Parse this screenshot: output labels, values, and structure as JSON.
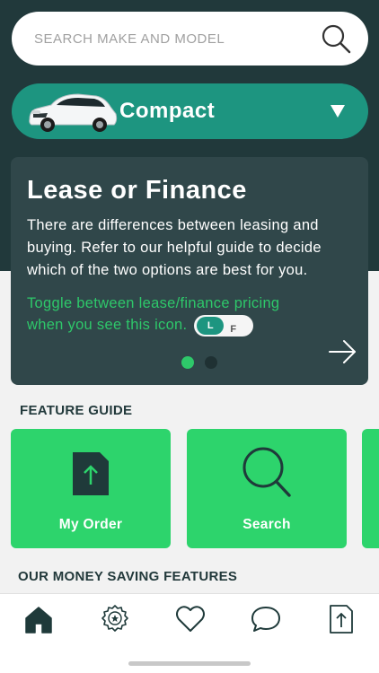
{
  "search": {
    "placeholder": "SEARCH MAKE AND MODEL"
  },
  "category": {
    "label": "Compact"
  },
  "promo": {
    "title": "Lease or Finance",
    "body": "There are differences between leasing and buying. Refer to our helpful guide to decide which of the two options are best for you.",
    "hint": "Toggle between lease/finance pricing when you see this icon.",
    "toggle": {
      "left": "L",
      "right": "F"
    },
    "pager": {
      "total": 2,
      "active": 1
    }
  },
  "feature_guide": {
    "title": "FEATURE GUIDE",
    "items": [
      {
        "label": "My Order",
        "icon": "order-document-icon"
      },
      {
        "label": "Search",
        "icon": "search-icon"
      }
    ]
  },
  "money_saving": {
    "title": "OUR MONEY SAVING FEATURES"
  },
  "tabbar": {
    "items": [
      {
        "name": "home",
        "icon": "home-icon",
        "active": true
      },
      {
        "name": "deals",
        "icon": "badge-icon"
      },
      {
        "name": "favorites",
        "icon": "heart-icon"
      },
      {
        "name": "messages",
        "icon": "chat-icon"
      },
      {
        "name": "share",
        "icon": "share-icon"
      }
    ]
  },
  "colors": {
    "dark": "#21393b",
    "teal": "#1d9580",
    "green": "#2dd46c",
    "card": "#30474a"
  }
}
